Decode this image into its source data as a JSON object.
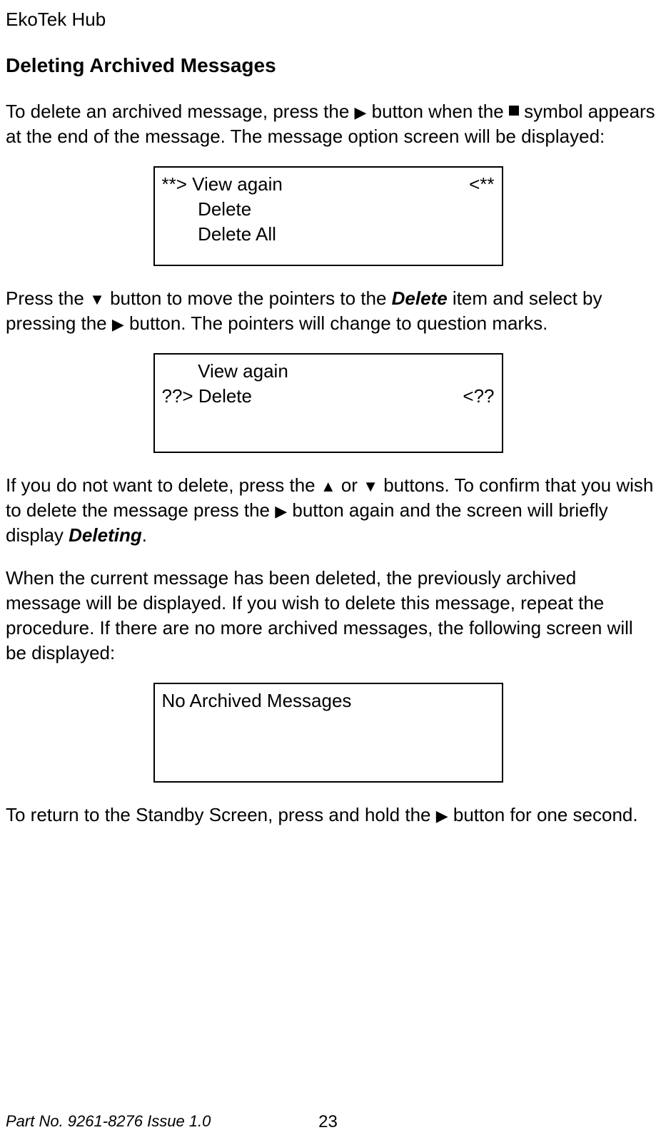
{
  "header": "EkoTek Hub",
  "section_title": "Deleting Archived Messages",
  "p1_a": "To delete an archived message, press the ",
  "p1_b": " button when the ",
  "p1_c": " symbol appears at the end of the message.  The message option screen will be displayed:",
  "screen1": {
    "row1_left": "**> View again",
    "row1_right": "<**",
    "row2": "       Delete",
    "row3": "       Delete All"
  },
  "p2_a": "Press the ",
  "p2_b": " button to move the pointers to the ",
  "p2_delete": "Delete",
  "p2_c": " item and select by pressing the ",
  "p2_d": " button.  The pointers will change to question marks.",
  "screen2": {
    "row1": "       View again",
    "row2_left": "??> Delete",
    "row2_right": "<??"
  },
  "p3_a": "If you do not want to delete, press the ",
  "p3_b": " or ",
  "p3_c": " buttons.  To confirm that you wish to delete the message press the ",
  "p3_d": " button again and the screen will briefly display ",
  "p3_deleting": "Deleting",
  "p3_e": ".",
  "p4": "When the current message has been deleted, the previously archived message will be displayed.  If you wish to delete this message, repeat the procedure.  If there are no more archived messages, the following screen will be displayed:",
  "screen3": {
    "row1": "No Archived Messages"
  },
  "p5_a": "To return to the Standby Screen, press and hold the ",
  "p5_b": " button for one second.",
  "footer_left": "Part No. 9261-8276  Issue 1.0",
  "footer_page": "23",
  "icons": {
    "right": "▶",
    "down": "▼",
    "up": "▲"
  }
}
